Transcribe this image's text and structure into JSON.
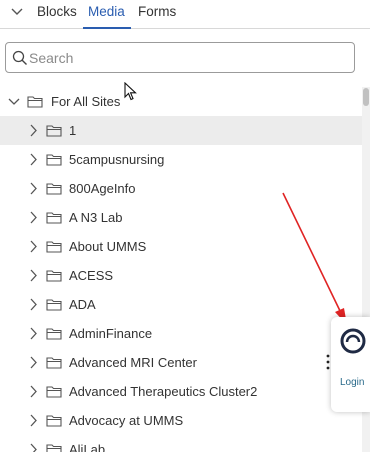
{
  "tabs": {
    "items": [
      {
        "label": "Blocks",
        "active": false
      },
      {
        "label": "Media",
        "active": true
      },
      {
        "label": "Forms",
        "active": false
      }
    ]
  },
  "search": {
    "placeholder": "Search",
    "value": ""
  },
  "tree": {
    "root": {
      "label": "For All Sites",
      "expanded": true
    },
    "children": [
      {
        "label": "1",
        "selected": true
      },
      {
        "label": "5campusnursing"
      },
      {
        "label": "800AgeInfo"
      },
      {
        "label": "A N3 Lab"
      },
      {
        "label": "About UMMS"
      },
      {
        "label": "ACESS"
      },
      {
        "label": "ADA"
      },
      {
        "label": "AdminFinance"
      },
      {
        "label": "Advanced MRI Center"
      },
      {
        "label": "Advanced Therapeutics Cluster2"
      },
      {
        "label": "Advocacy at UMMS"
      },
      {
        "label": "AliLab"
      }
    ]
  },
  "widget": {
    "login_label": "Login",
    "icon": "power-logo-icon"
  },
  "colors": {
    "accent": "#2a5db0",
    "annotation_arrow": "#e02424",
    "selected_row": "#ececec"
  }
}
